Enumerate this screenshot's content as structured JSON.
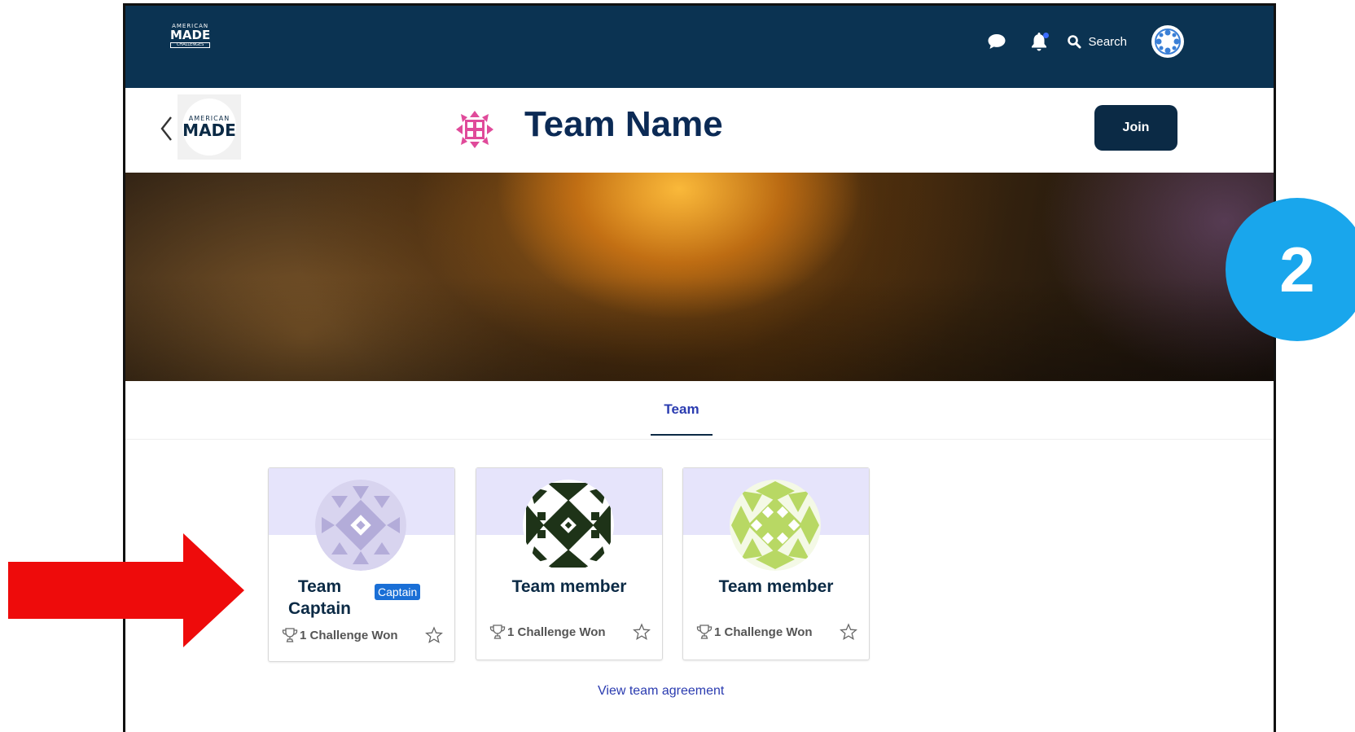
{
  "brand": {
    "nav_logo_line1": "AMERICAN",
    "nav_logo_line2": "MADE",
    "nav_logo_line3": "CHALLENGES",
    "header_logo_line1": "AMERICAN",
    "header_logo_line2": "MADE"
  },
  "topnav": {
    "search_label": "Search",
    "icons": [
      "chat-icon",
      "bell-icon",
      "search-icon",
      "user-avatar"
    ]
  },
  "header": {
    "team_title": "Team Name",
    "join_label": "Join"
  },
  "tabs": [
    {
      "label": "Team",
      "active": true
    }
  ],
  "members": [
    {
      "name": "Team Captain",
      "badge": "Captain",
      "challenges": "1 Challenge Won",
      "avatar_color": "#b3acd9"
    },
    {
      "name": "Team member",
      "badge": "",
      "challenges": "1 Challenge Won",
      "avatar_color": "#1e3318"
    },
    {
      "name": "Team member",
      "badge": "",
      "challenges": "1 Challenge Won",
      "avatar_color": "#b8d864"
    }
  ],
  "agreement_link": "View team agreement",
  "annotation": {
    "step_number": "2",
    "arrow_color": "#ee0b0b",
    "circle_color": "#19a6ec"
  },
  "colors": {
    "nav_bg": "#0b3352",
    "title": "#0b2a55",
    "link": "#2a3bb0",
    "card_top": "#e6e4fb",
    "badge": "#1a6fd6"
  }
}
